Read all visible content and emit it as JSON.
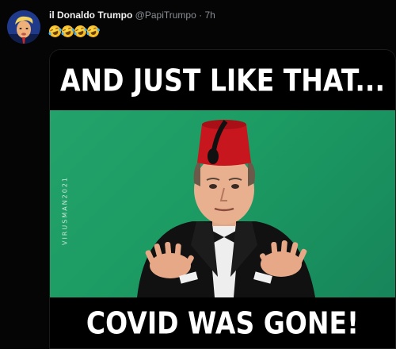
{
  "tweet": {
    "display_name": "il Donaldo Trumpo",
    "handle": "@PapiTrumpo",
    "separator": "·",
    "time": "7h",
    "emojis": [
      "rolling-on-floor-laughing",
      "rolling-on-floor-laughing",
      "rolling-on-floor-laughing",
      "rolling-on-floor-laughing"
    ],
    "avatar_icon": "trump-caricature-avatar"
  },
  "meme": {
    "top_text": "AND JUST LIKE THAT...",
    "bottom_text": "COVID WAS GONE!",
    "watermark": "VIRUSMAN2021",
    "background_color": "#1f9e66"
  }
}
